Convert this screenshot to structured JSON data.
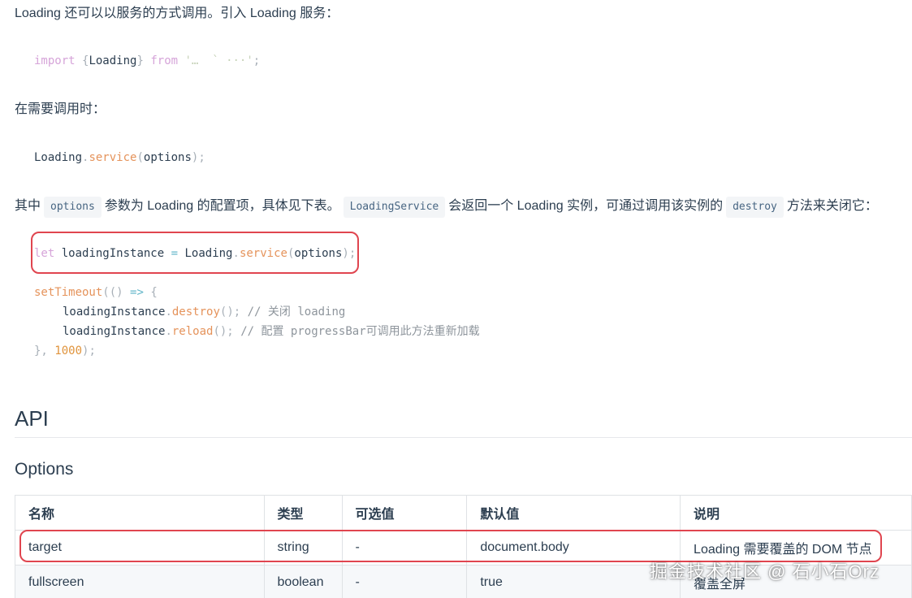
{
  "intro": {
    "text": "Loading 还可以以服务的方式调用。引入 Loading 服务："
  },
  "import_line": {
    "kw_import": "import",
    "open_brace": "{",
    "name": "Loading",
    "close_brace": "}",
    "kw_from": "from",
    "path_text": "'…  ` ···'",
    "semicolon": ";"
  },
  "call_para": {
    "text": "在需要调用时："
  },
  "service_line": {
    "obj": "Loading",
    "dot": ".",
    "method": "service",
    "open": "(",
    "arg": "options",
    "close": ");"
  },
  "desc": {
    "part1": "其中",
    "code1": "options",
    "part2": "参数为 Loading 的配置项，具体见下表。",
    "code2": "LoadingService",
    "part3": "会返回一个 Loading 实例，可通过调用该实例的",
    "code3": "destroy",
    "part4": "方法来关闭它："
  },
  "code_block": {
    "line1": {
      "kw": "let",
      "var": "loadingInstance",
      "eq": "=",
      "obj": "Loading",
      "dot": ".",
      "method": "service",
      "open": "(",
      "arg": "options",
      "close": ");"
    },
    "line2": {
      "fn": "setTimeout",
      "open": "((",
      "close": ")",
      "arrow": "=>",
      "brace": "{"
    },
    "line3": {
      "obj": "loadingInstance",
      "dot": ".",
      "method": "destroy",
      "parens": "();",
      "comment": "// 关闭 loading"
    },
    "line4": {
      "obj": "loadingInstance",
      "dot": ".",
      "method": "reload",
      "parens": "();",
      "comment": "// 配置 progressBar可调用此方法重新加载"
    },
    "line5": {
      "close": "},",
      "num": "1000",
      "end": ");"
    }
  },
  "api": {
    "heading": "API",
    "subheading": "Options"
  },
  "table": {
    "headers": [
      "名称",
      "类型",
      "可选值",
      "默认值",
      "说明"
    ],
    "rows": [
      [
        "target",
        "string",
        "-",
        "document.body",
        "Loading 需要覆盖的 DOM 节点"
      ],
      [
        "fullscreen",
        "boolean",
        "-",
        "true",
        "覆盖全屏"
      ]
    ]
  },
  "watermark": {
    "text": "掘金技术社区 @ 石小石Orz"
  },
  "colors": {
    "highlight_border": "#e0454f",
    "text": "#2c3e50",
    "keyword": "#d6a4d9",
    "function": "#e5935b",
    "comment": "#8e959c"
  }
}
